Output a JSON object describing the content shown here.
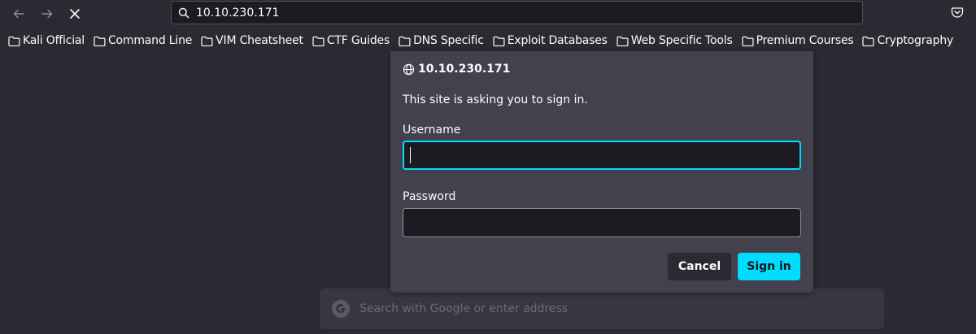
{
  "urlbar": {
    "url": "10.10.230.171"
  },
  "bookmarks": [
    {
      "label": "Kali Official"
    },
    {
      "label": "Command Line"
    },
    {
      "label": "VIM Cheatsheet"
    },
    {
      "label": "CTF Guides"
    },
    {
      "label": "DNS Specific"
    },
    {
      "label": "Exploit Databases"
    },
    {
      "label": "Web Specific Tools"
    },
    {
      "label": "Premium Courses"
    },
    {
      "label": "Cryptography"
    }
  ],
  "dialog": {
    "host": "10.10.230.171",
    "message": "This site is asking you to sign in.",
    "username_label": "Username",
    "username_value": "",
    "password_label": "Password",
    "password_value": "",
    "cancel_label": "Cancel",
    "signin_label": "Sign in"
  },
  "newtab": {
    "search_placeholder": "Search with Google or enter address"
  },
  "colors": {
    "accent": "#00ddff",
    "background": "#2b2a33",
    "dialog": "#42414d"
  }
}
